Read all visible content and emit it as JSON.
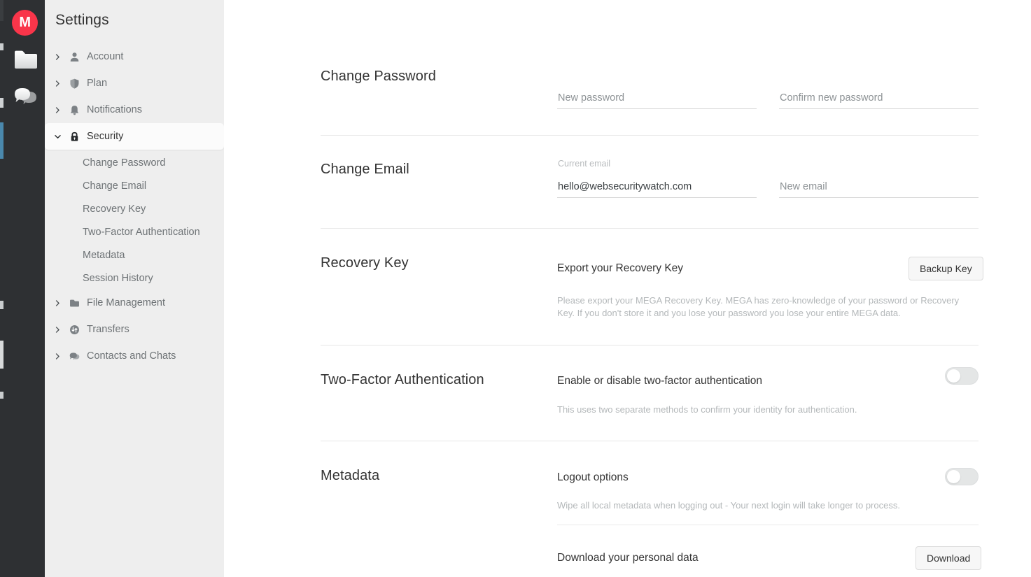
{
  "rail": {
    "logo_letter": "M",
    "items": [
      {
        "name": "cloud-drive-icon"
      },
      {
        "name": "chat-icon"
      }
    ]
  },
  "sidebar": {
    "title": "Settings",
    "items": [
      {
        "label": "Account",
        "icon": "user-icon",
        "expanded": false
      },
      {
        "label": "Plan",
        "icon": "shield-icon",
        "expanded": false
      },
      {
        "label": "Notifications",
        "icon": "bell-icon",
        "expanded": false
      },
      {
        "label": "Security",
        "icon": "lock-icon",
        "expanded": true,
        "active": true
      },
      {
        "label": "File Management",
        "icon": "folder-icon",
        "expanded": false
      },
      {
        "label": "Transfers",
        "icon": "transfer-icon",
        "expanded": false
      },
      {
        "label": "Contacts and Chats",
        "icon": "chats-icon",
        "expanded": false
      }
    ],
    "security_subitems": [
      {
        "label": "Change Password"
      },
      {
        "label": "Change Email"
      },
      {
        "label": "Recovery Key"
      },
      {
        "label": "Two-Factor Authentication"
      },
      {
        "label": "Metadata"
      },
      {
        "label": "Session History"
      }
    ]
  },
  "header": {
    "search_icon": "search-icon",
    "notifications_icon": "bell-icon",
    "avatar_letter": "M",
    "status": "online"
  },
  "sections": {
    "change_password": {
      "title": "Change Password",
      "new_password_placeholder": "New password",
      "new_password_value": "",
      "confirm_password_placeholder": "Confirm new password",
      "confirm_password_value": ""
    },
    "change_email": {
      "title": "Change Email",
      "current_email_caption": "Current email",
      "current_email_value": "hello@websecuritywatch.com",
      "new_email_placeholder": "New email",
      "new_email_value": ""
    },
    "recovery_key": {
      "title": "Recovery Key",
      "row_label": "Export your Recovery Key",
      "button_label": "Backup Key",
      "description": "Please export your MEGA Recovery Key. MEGA has zero-knowledge of your password or Recovery Key. If you don't store it and you lose your password you lose your entire MEGA data."
    },
    "two_factor": {
      "title": "Two-Factor Authentication",
      "row_label": "Enable or disable two-factor authentication",
      "toggle_state": "off",
      "description": "This uses two separate methods to confirm your identity for authentication."
    },
    "metadata": {
      "title": "Metadata",
      "logout_label": "Logout options",
      "logout_toggle_state": "off",
      "logout_description": "Wipe all local metadata when logging out - Your next login will take longer to process.",
      "download_label": "Download your personal data",
      "download_button_label": "Download"
    }
  },
  "colors": {
    "brand_red": "#f9354a",
    "rail_dark": "#2e3033",
    "sidebar_bg": "#eeeeee",
    "avatar_blue": "#8fdbf5",
    "status_green": "#3cca5a"
  }
}
